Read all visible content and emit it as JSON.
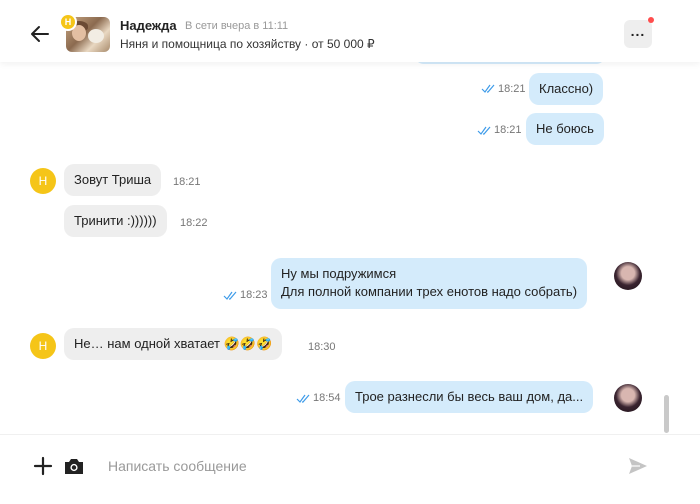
{
  "header": {
    "contact_name": "Надежда",
    "status": "В сети вчера в 11:11",
    "subtitle": "Няня и помощница по хозяйству · от 50 000 ₽",
    "avatar_badge": "Н"
  },
  "messages": [
    {
      "direction": "out",
      "text": "Классно)",
      "time": "18:21",
      "read": true
    },
    {
      "direction": "out",
      "text": "Не боюсь",
      "time": "18:21",
      "read": true
    },
    {
      "direction": "in",
      "text": "Зовут Триша",
      "time": "18:21",
      "avatar": "Н"
    },
    {
      "direction": "in",
      "text": "Тринити :))))))",
      "time": "18:22"
    },
    {
      "direction": "out",
      "text_line1": "Ну мы подружимся",
      "text_line2": "Для полной компании трех енотов надо собрать)",
      "time": "18:23",
      "read": true
    },
    {
      "direction": "in",
      "text": "Не… нам одной хватает 🤣🤣🤣",
      "time": "18:30",
      "avatar": "Н"
    },
    {
      "direction": "out",
      "text": "Трое разнесли бы весь ваш дом, да...",
      "time": "18:54",
      "read": true
    }
  ],
  "composer": {
    "placeholder": "Написать сообщение"
  },
  "colors": {
    "outgoing_bubble": "#d4ebfb",
    "incoming_bubble": "#eeeeee",
    "avatar_yellow": "#f5c518",
    "tick_blue": "#3d9be9",
    "notification_dot": "#ff4d4d"
  },
  "icons": {
    "back": "arrow-left-icon",
    "more": "more-dots-icon",
    "add": "plus-icon",
    "camera": "camera-icon",
    "send": "send-icon",
    "read": "double-check-icon"
  }
}
